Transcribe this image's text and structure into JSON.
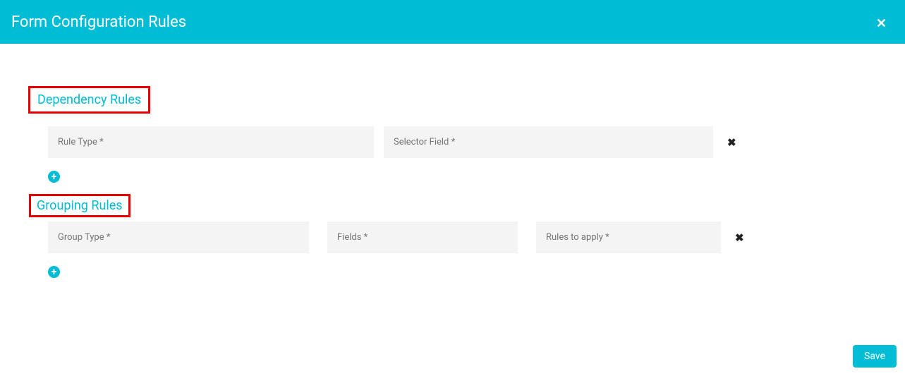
{
  "header": {
    "title": "Form Configuration Rules"
  },
  "sections": {
    "dependency": {
      "title": "Dependency Rules",
      "fields": {
        "rule_type_placeholder": "Rule Type *",
        "selector_field_placeholder": "Selector Field *"
      }
    },
    "grouping": {
      "title": "Grouping Rules",
      "fields": {
        "group_type_placeholder": "Group Type *",
        "fields_placeholder": "Fields *",
        "rules_to_apply_placeholder": "Rules to apply *"
      }
    }
  },
  "buttons": {
    "save": "Save"
  },
  "icons": {
    "close": "✕",
    "remove": "✖",
    "add": "+"
  }
}
